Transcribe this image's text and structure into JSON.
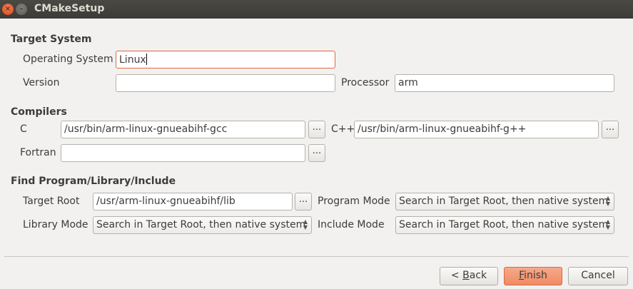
{
  "window": {
    "title": "CMakeSetup",
    "close_glyph": "×",
    "minimize_glyph": "–"
  },
  "target_system": {
    "heading": "Target System",
    "os_label": "Operating System",
    "os_value": "Linux",
    "version_label": "Version",
    "version_value": "",
    "processor_label": "Processor",
    "processor_value": "arm"
  },
  "compilers": {
    "heading": "Compilers",
    "c_label": "C",
    "c_value": "/usr/bin/arm-linux-gnueabihf-gcc",
    "cxx_label": "C++",
    "cxx_value": "/usr/bin/arm-linux-gnueabihf-g++",
    "fortran_label": "Fortran",
    "fortran_value": "",
    "browse_label": "..."
  },
  "find": {
    "heading": "Find Program/Library/Include",
    "target_root_label": "Target Root",
    "target_root_value": "/usr/arm-linux-gnueabihf/lib",
    "program_mode_label": "Program Mode",
    "program_mode_value": "Search in Target Root, then native system",
    "library_mode_label": "Library Mode",
    "library_mode_value": "Search in Target Root, then native system",
    "include_mode_label": "Include Mode",
    "include_mode_value": "Search in Target Root, then native system"
  },
  "buttons": {
    "back_prefix": "< ",
    "back_mnemonic": "B",
    "back_rest": "ack",
    "finish_mnemonic": "F",
    "finish_rest": "inish",
    "cancel": "Cancel"
  },
  "colors": {
    "accent": "#e7663d",
    "titlebar": "#3c3b37",
    "window_bg": "#f2f1f0"
  }
}
